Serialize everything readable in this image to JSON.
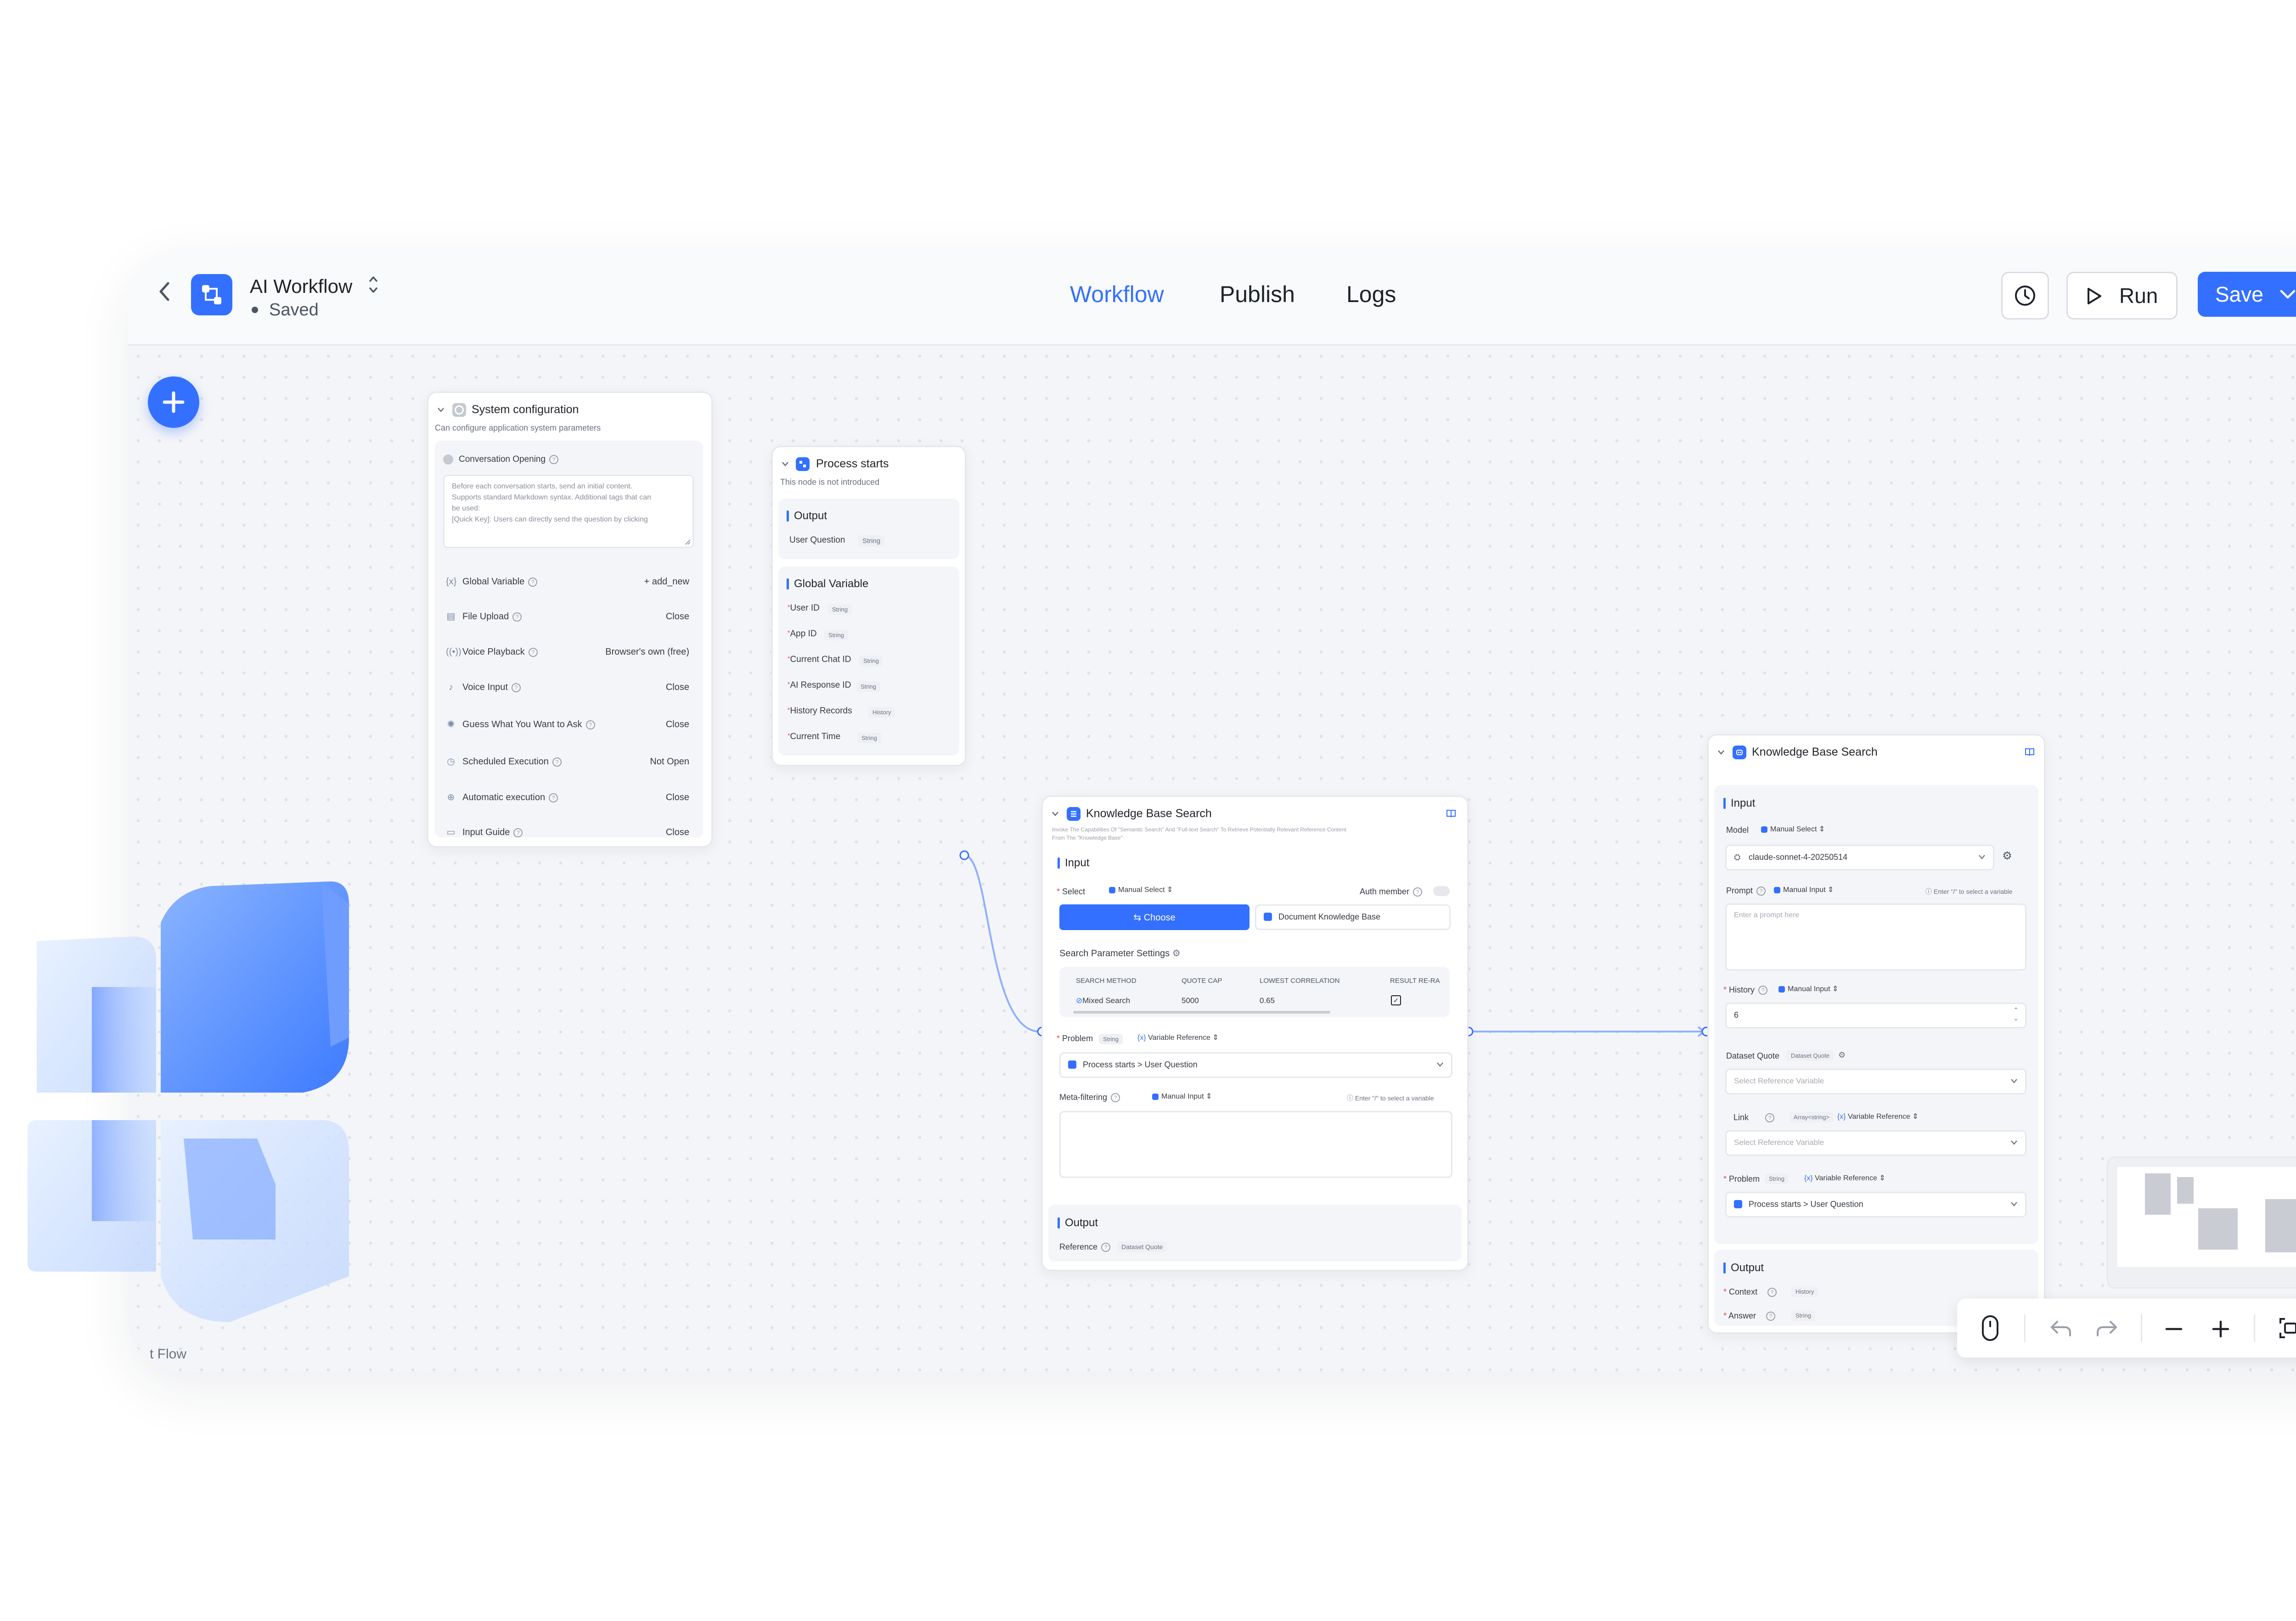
{
  "header": {
    "title": "AI Workflow",
    "status": "Saved",
    "tabs": [
      {
        "label": "Workflow",
        "active": true
      },
      {
        "label": "Publish",
        "active": false
      },
      {
        "label": "Logs",
        "active": false
      }
    ],
    "run_label": "Run",
    "save_label": "Save"
  },
  "colors": {
    "accent": "#3370ff",
    "background": "#f4f5f8"
  },
  "system_config": {
    "title": "System configuration",
    "subtitle": "Can configure application system parameters",
    "opening_label": "Conversation Opening",
    "opening_text": [
      "Before each conversation starts, send an initial content.",
      "Supports standard Markdown syntax. Additional tags that can",
      "be used:",
      "[Quick Key]: Users can directly send the question by clicking"
    ],
    "rows": [
      {
        "icon": "{x}",
        "label": "Global Variable",
        "value": "+ add_new"
      },
      {
        "icon": "▤",
        "label": "File Upload",
        "value": "Close"
      },
      {
        "icon": "((•))",
        "label": "Voice Playback",
        "value": "Browser's own (free)"
      },
      {
        "icon": "♪",
        "label": "Voice Input",
        "value": "Close"
      },
      {
        "icon": "✺",
        "label": "Guess What You Want to Ask",
        "value": "Close"
      },
      {
        "icon": "◷",
        "label": "Scheduled Execution",
        "value": "Not Open"
      },
      {
        "icon": "⊕",
        "label": "Automatic execution",
        "value": "Close"
      },
      {
        "icon": "▭",
        "label": "Input Guide",
        "value": "Close"
      }
    ]
  },
  "process_starts": {
    "title": "Process starts",
    "subtitle": "This node is not introduced",
    "output_title": "Output",
    "output_items": [
      {
        "label": "User Question",
        "type": "String"
      }
    ],
    "global_title": "Global Variable",
    "global_items": [
      {
        "label": "User ID",
        "type": "String"
      },
      {
        "label": "App ID",
        "type": "String"
      },
      {
        "label": "Current Chat ID",
        "type": "String"
      },
      {
        "label": "AI Response ID",
        "type": "String"
      },
      {
        "label": "History Records",
        "type": "History"
      },
      {
        "label": "Current Time",
        "type": "String"
      }
    ]
  },
  "kb_search": {
    "title": "Knowledge Base Search",
    "description_1": "Invoke The Capabilities Of \"Semantic Search\" And \"Full-text Search\" To Retrieve Potentially Relevant Reference Content",
    "description_2": "From The \"Knowledge Base\"",
    "input_title": "Input",
    "select_label": "Select",
    "select_mode": "Manual Select",
    "auth_label": "Auth member",
    "choose_label": "Choose",
    "kb_name": "Document Knowledge Base",
    "params_label": "Search Parameter Settings",
    "table_headers": [
      "SEARCH METHOD",
      "QUOTE CAP",
      "LOWEST CORRELATION",
      "RESULT RE-RA"
    ],
    "table_row": [
      "Mixed Search",
      "5000",
      "0.65",
      ""
    ],
    "problem_label": "Problem",
    "problem_type": "String",
    "problem_mode": "Variable Reference",
    "problem_source": "Process starts",
    "problem_value": "User Question",
    "meta_label": "Meta-filtering",
    "meta_mode": "Manual Input",
    "meta_hint": "Enter \"/\" to select a variable",
    "output_title": "Output",
    "output_label": "Reference",
    "output_type": "Dataset Quote"
  },
  "ai_node": {
    "title": "Knowledge Base Search",
    "input_title": "Input",
    "model_label": "Model",
    "model_mode": "Manual Select",
    "model_value": "claude-sonnet-4-20250514",
    "prompt_label": "Prompt",
    "prompt_mode": "Manual Input",
    "prompt_hint": "Enter \"/\" to select a variable",
    "prompt_placeholder": "Enter a prompt here",
    "history_label": "History",
    "history_mode": "Manual Input",
    "history_value": "6",
    "dataset_label": "Dataset Quote",
    "dataset_type": "Dataset Quote",
    "dataset_placeholder": "Select Reference Variable",
    "link_label": "Link",
    "link_type": "Array<string>",
    "link_mode": "Variable Reference",
    "link_placeholder": "Select Reference Variable",
    "problem_label": "Problem",
    "problem_type": "String",
    "problem_mode": "Variable Reference",
    "problem_source": "Process starts",
    "problem_value": "User Question",
    "output_title": "Output",
    "outputs": [
      {
        "label": "Context",
        "type": "History"
      },
      {
        "label": "Answer",
        "type": "String"
      }
    ]
  },
  "footer_partial_text": "t Flow"
}
